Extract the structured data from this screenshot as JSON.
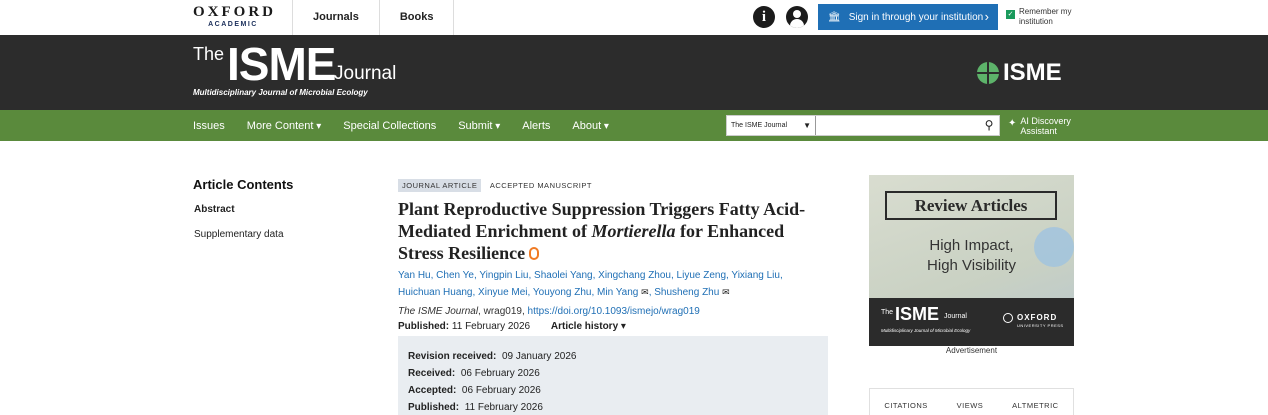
{
  "topbar": {
    "publisher_line1": "OXFORD",
    "publisher_line2": "ACADEMIC",
    "nav": [
      "Journals",
      "Books"
    ],
    "info_glyph": "i",
    "signin_label": "Sign in through your institution",
    "remember_label": "Remember my institution"
  },
  "banner": {
    "the": "The",
    "isme": "ISME",
    "journal": "Journal",
    "subtitle": "Multidisciplinary Journal of Microbial Ecology",
    "society_logo": "ISME"
  },
  "nav": {
    "issues": "Issues",
    "more_content": "More Content",
    "special_collections": "Special Collections",
    "submit": "Submit",
    "alerts": "Alerts",
    "about": "About",
    "search_scope": "The ISME Journal",
    "search_placeholder": "",
    "ai_label_1": "AI Discovery",
    "ai_label_2": "Assistant"
  },
  "toc": {
    "title": "Article Contents",
    "items": [
      "Abstract",
      "Supplementary data"
    ]
  },
  "article": {
    "type": "JOURNAL ARTICLE",
    "status": "ACCEPTED MANUSCRIPT",
    "title_a": "Plant Reproductive Suppression Triggers Fatty Acid-Mediated Enrichment of ",
    "title_em": "Mortierella",
    "title_b": " for Enhanced Stress Resilience",
    "authors_line1": "Yan Hu, Chen Ye, Yingpin Liu, Shaolei Yang, Xingchang Zhou, Liyue Zeng, Yixiang Liu,",
    "authors_line2a": "Huichuan Huang, Xinyue Mei, Youyong Zhu, Min Yang",
    "authors_line2b": "Shusheng Zhu",
    "journal_name": "The ISME Journal",
    "article_id": ", wrag019, ",
    "doi": "https://doi.org/10.1093/ismejo/wrag019",
    "published_label": "Published:",
    "published_date": "11 February 2026",
    "history_label": "Article history"
  },
  "history": [
    {
      "label": "Revision received:",
      "date": "09 January 2026"
    },
    {
      "label": "Received:",
      "date": "06 February 2026"
    },
    {
      "label": "Accepted:",
      "date": "06 February 2026"
    },
    {
      "label": "Published:",
      "date": "11 February 2026"
    }
  ],
  "ad": {
    "heading": "Review Articles",
    "line1": "High Impact,",
    "line2": "High Visibility",
    "footer_the": "The",
    "footer_isme": "ISME",
    "footer_journal": "Journal",
    "footer_sub": "Multidisciplinary Journal of Microbial Ecology",
    "footer_oup": "OXFORD",
    "footer_oup2": "UNIVERSITY PRESS",
    "caption": "Advertisement"
  },
  "metrics": [
    "CITATIONS",
    "VIEWS",
    "ALTMETRIC"
  ],
  "colors": {
    "nav_green": "#5a8a3c",
    "banner_dark": "#2c2c2c",
    "link_blue": "#1f6fb5",
    "signin_blue": "#1f6fb5",
    "open_access_orange": "#f07b24"
  }
}
